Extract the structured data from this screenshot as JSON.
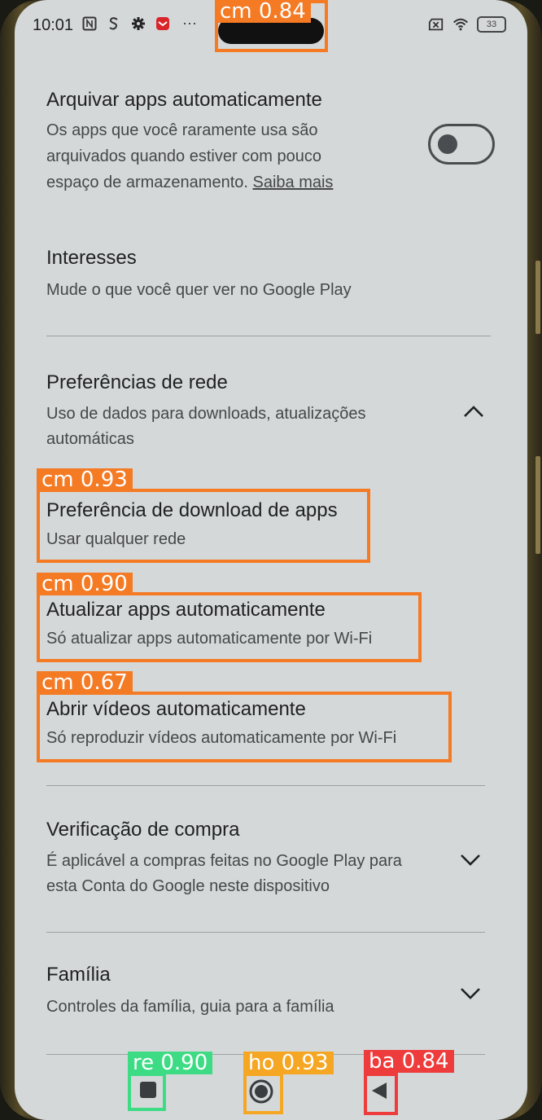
{
  "status": {
    "time": "10:01",
    "battery": "33",
    "left_icons": [
      "nfc-icon",
      "s-icon",
      "gear-icon",
      "app-notification-icon"
    ],
    "more": "···"
  },
  "settings": {
    "archive": {
      "title": "Arquivar apps automaticamente",
      "desc_lines": [
        "Os apps que você raramente usa são",
        "arquivados quando estiver com pouco"
      ],
      "desc_last": "espaço de armazenamento. ",
      "link": "Saiba mais",
      "toggle_on": false
    },
    "interests": {
      "title": "Interesses",
      "desc": "Mude o que você quer ver no Google Play"
    },
    "network": {
      "title": "Preferências de rede",
      "desc_lines": [
        "Uso de dados para downloads, atualizações",
        "automáticas"
      ],
      "expanded": true
    },
    "download_pref": {
      "title": "Preferência de download de apps",
      "desc": "Usar qualquer rede"
    },
    "auto_update": {
      "title": "Atualizar apps automaticamente",
      "desc": "Só atualizar apps automaticamente por Wi-Fi"
    },
    "auto_video": {
      "title": "Abrir vídeos automaticamente",
      "desc": "Só reproduzir vídeos automaticamente por Wi-Fi"
    },
    "purchase": {
      "title": "Verificação de compra",
      "desc_lines": [
        "É aplicável a compras feitas no Google Play para",
        "esta Conta do Google neste dispositivo"
      ],
      "expanded": false
    },
    "family": {
      "title": "Família",
      "desc": "Controles da família, guia para a família",
      "expanded": false
    }
  },
  "detections": [
    {
      "label": "cm 0.84",
      "color": "#f47a24"
    },
    {
      "label": "cm 0.93",
      "color": "#f47a24"
    },
    {
      "label": "cm 0.90",
      "color": "#f47a24"
    },
    {
      "label": "cm 0.67",
      "color": "#f47a24"
    },
    {
      "label": "re 0.90",
      "color": "#3ddc84"
    },
    {
      "label": "ho 0.93",
      "color": "#f5a623"
    },
    {
      "label": "ba 0.84",
      "color": "#ee3b3b"
    }
  ]
}
